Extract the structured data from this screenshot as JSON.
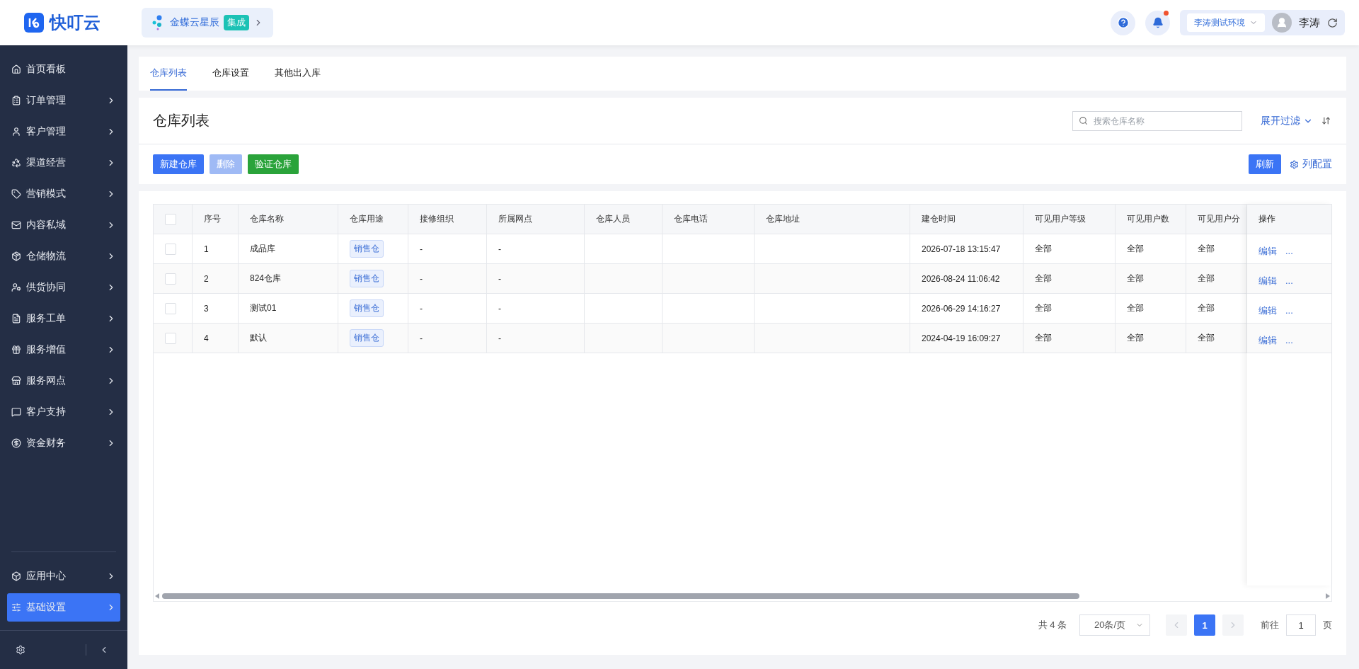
{
  "header": {
    "logo": "快叮云",
    "app_chip": {
      "name": "金蝶云星辰",
      "badge": "集成"
    },
    "notifications_unread": true,
    "environment": "李涛测试环境",
    "user": "李涛"
  },
  "sidebar": {
    "items": [
      {
        "label": "首页看板",
        "selected": false,
        "has_children": false
      },
      {
        "label": "订单管理",
        "selected": false,
        "has_children": true
      },
      {
        "label": "客户管理",
        "selected": false,
        "has_children": true
      },
      {
        "label": "渠道经营",
        "selected": false,
        "has_children": true
      },
      {
        "label": "营销模式",
        "selected": false,
        "has_children": true
      },
      {
        "label": "内容私域",
        "selected": false,
        "has_children": true
      },
      {
        "label": "仓储物流",
        "selected": false,
        "has_children": true
      },
      {
        "label": "供货协同",
        "selected": false,
        "has_children": true
      },
      {
        "label": "服务工单",
        "selected": false,
        "has_children": true
      },
      {
        "label": "服务增值",
        "selected": false,
        "has_children": true
      },
      {
        "label": "服务网点",
        "selected": false,
        "has_children": true
      },
      {
        "label": "客户支持",
        "selected": false,
        "has_children": true
      },
      {
        "label": "资金财务",
        "selected": false,
        "has_children": true
      }
    ],
    "bottom_items": [
      {
        "label": "应用中心",
        "selected": false,
        "has_children": true
      },
      {
        "label": "基础设置",
        "selected": true,
        "has_children": true
      }
    ]
  },
  "tabs": [
    {
      "label": "仓库列表",
      "selected": true
    },
    {
      "label": "仓库设置",
      "selected": false
    },
    {
      "label": "其他出入库",
      "selected": false
    }
  ],
  "page_title": "仓库列表",
  "search": {
    "placeholder": "搜索仓库名称"
  },
  "filter_toggle": "展开过滤",
  "toolbar": {
    "buttons": [
      {
        "label": "新建仓库",
        "kind": "primary",
        "disabled": false
      },
      {
        "label": "删除",
        "kind": "primary",
        "disabled": true
      },
      {
        "label": "验证仓库",
        "kind": "success",
        "disabled": false
      }
    ],
    "refresh": "刷新",
    "column_config": "列配置"
  },
  "table": {
    "header_checked": false,
    "columns": [
      "序号",
      "仓库名称",
      "仓库用途",
      "接修组织",
      "所属网点",
      "仓库人员",
      "仓库电话",
      "仓库地址",
      "建仓时间",
      "可见用户等级",
      "可见用户数",
      "可见用户分"
    ],
    "actions_column": "操作",
    "rows": [
      {
        "checked": false,
        "cells": [
          "1",
          "成品库",
          "销售仓",
          "-",
          "-",
          null,
          null,
          null,
          "2026-07-18 13:15:47",
          "全部",
          "全部",
          "全部"
        ],
        "actions": [
          "编辑",
          "..."
        ]
      },
      {
        "checked": false,
        "cells": [
          "2",
          "824仓库",
          "销售仓",
          "-",
          "-",
          null,
          null,
          null,
          "2026-08-24 11:06:42",
          "全部",
          "全部",
          "全部"
        ],
        "actions": [
          "编辑",
          "..."
        ]
      },
      {
        "checked": false,
        "cells": [
          "3",
          "测试01",
          "销售仓",
          "-",
          "-",
          null,
          null,
          null,
          "2026-06-29 14:16:27",
          "全部",
          "全部",
          "全部"
        ],
        "actions": [
          "编辑",
          "..."
        ]
      },
      {
        "checked": false,
        "cells": [
          "4",
          "默认",
          "销售仓",
          "-",
          "-",
          null,
          null,
          null,
          "2024-04-19 16:09:27",
          "全部",
          "全部",
          "全部"
        ],
        "actions": [
          "编辑",
          "..."
        ]
      }
    ]
  },
  "pagination": {
    "total": "共 4 条",
    "page_size": "20条/页",
    "prev_disabled": true,
    "next_disabled": true,
    "pages": [
      {
        "label": "1",
        "selected": true
      }
    ],
    "goto_label": "前往",
    "goto_value": "1",
    "goto_suffix": "页"
  }
}
